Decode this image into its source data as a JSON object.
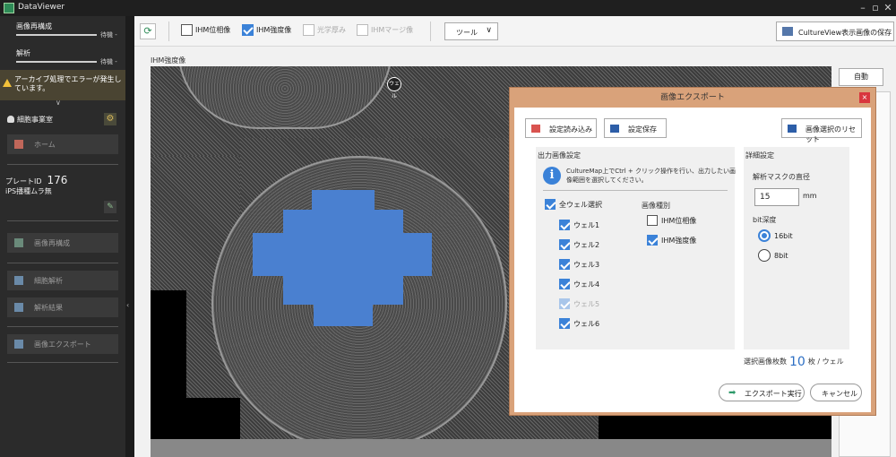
{
  "app": {
    "title": "DataViewer"
  },
  "sidebar": {
    "jobs": [
      {
        "name": "画像再構成",
        "status": "待機 -"
      },
      {
        "name": "解析",
        "status": "待機 -"
      }
    ],
    "error_text": "アーカイブ処理でエラーが発生しています。",
    "user": "細胞事業室",
    "home_label": "ホーム",
    "plate_label": "プレートID",
    "plate_id": "176",
    "plate_name": "iPS播種ムラ無",
    "menu": [
      "画像再構成",
      "細胞解析",
      "解析結果",
      "画像エクスポート"
    ]
  },
  "toolbar": {
    "checks": [
      {
        "label": "IHM位相像",
        "checked": false,
        "disabled": false
      },
      {
        "label": "IHM強度像",
        "checked": true,
        "disabled": false
      },
      {
        "label": "光学厚み",
        "checked": false,
        "disabled": true
      },
      {
        "label": "IHMマージ像",
        "checked": false,
        "disabled": true
      }
    ],
    "tool_label": "ツール",
    "save_label": "CultureView表示画像の保存"
  },
  "viewer": {
    "label": "IHM強度像",
    "well_badge": "ウェル"
  },
  "right": {
    "auto_label": "自動"
  },
  "dialog": {
    "title": "画像エクスポート",
    "close": "×",
    "load_label": "設定読み込み",
    "save_label": "設定保存",
    "reset_label": "画像選択のリセット",
    "output_title": "出力画像設定",
    "info_text": "CultureMap上でCtrl + クリック操作を行い、出力したい画像範囲を選択してください。",
    "all_wells_label": "全ウェル選択",
    "wells": [
      {
        "label": "ウェル1",
        "checked": true,
        "disabled": false
      },
      {
        "label": "ウェル2",
        "checked": true,
        "disabled": false
      },
      {
        "label": "ウェル3",
        "checked": true,
        "disabled": false
      },
      {
        "label": "ウェル4",
        "checked": true,
        "disabled": false
      },
      {
        "label": "ウェル5",
        "checked": true,
        "disabled": true
      },
      {
        "label": "ウェル6",
        "checked": true,
        "disabled": false
      }
    ],
    "type_title": "画像種別",
    "types": [
      {
        "label": "IHM位相像",
        "checked": false
      },
      {
        "label": "IHM強度像",
        "checked": true
      }
    ],
    "detail_title": "詳細設定",
    "mask_label": "解析マスクの直径",
    "mask_value": "15",
    "mask_unit": "mm",
    "bit_title": "bit深度",
    "bits": [
      {
        "label": "16bit",
        "selected": true
      },
      {
        "label": "8bit",
        "selected": false
      }
    ],
    "count_prefix": "選択画像枚数",
    "count_value": "10",
    "count_suffix": "枚 / ウェル",
    "export_label": "エクスポート実行",
    "cancel_label": "キャンセル"
  }
}
